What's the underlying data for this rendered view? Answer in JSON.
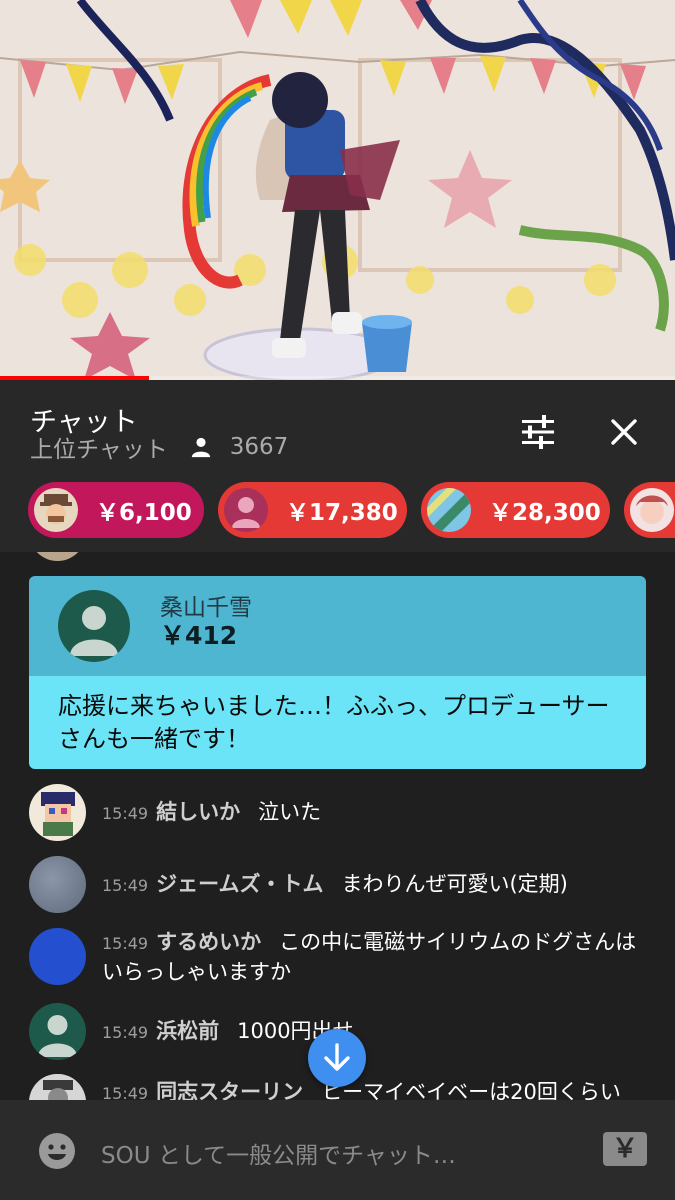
{
  "video": {
    "progress_fraction": 0.22
  },
  "header": {
    "title": "チャット",
    "mode": "上位チャット",
    "viewer_count": "3667"
  },
  "tickers": [
    {
      "amount": "￥6,100",
      "color": "#c2185b"
    },
    {
      "amount": "￥17,380",
      "color": "#e53935"
    },
    {
      "amount": "￥28,300",
      "color": "#e53935"
    },
    {
      "amount": "",
      "color": "#e53935"
    }
  ],
  "superchat": {
    "name": "桑山千雪",
    "amount": "￥412",
    "message": "応援に来ちゃいました…！ふふっ、プロデューサーさんも一緒です！",
    "header_color": "#4fb6d1",
    "body_color": "#6ae4f6"
  },
  "messages": [
    {
      "time": "15:49",
      "author": "結しいか",
      "text": "泣いた"
    },
    {
      "time": "15:49",
      "author": "ジェームズ・トム",
      "text": "まわりんぜ可愛い(定期)"
    },
    {
      "time": "15:49",
      "author": "するめいか",
      "text": "この中に電磁サイリウムのドグさんはいらっしゃいますか"
    },
    {
      "time": "15:49",
      "author": "浜松前",
      "text": "1000円出せ"
    },
    {
      "time": "15:49",
      "author": "同志スターリン",
      "text": "ヒーマイベイベーは20回くらい"
    }
  ],
  "input": {
    "placeholder": "SOU として一般公開でチャット…",
    "currency_icon": "￥"
  },
  "icons": {
    "filter": "tune-icon",
    "close": "close-icon",
    "viewer": "person-icon",
    "emoji": "emoji-icon",
    "scroll": "arrow-down-icon"
  }
}
